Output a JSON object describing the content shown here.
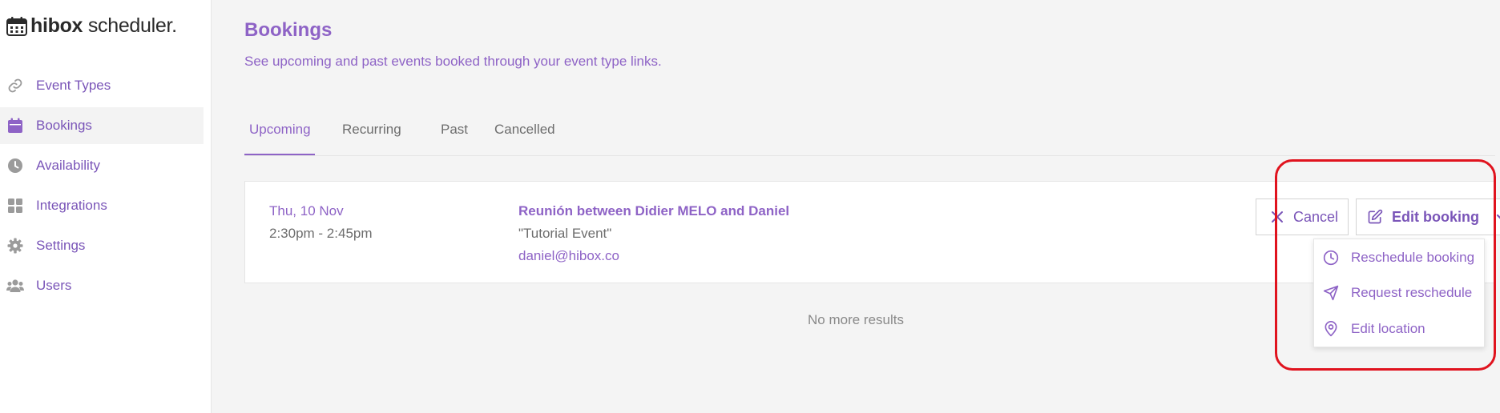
{
  "app": {
    "logo_bold": "hibox",
    "logo_light": " scheduler.",
    "logo_icon": "calendar-icon"
  },
  "sidebar": {
    "items": [
      {
        "label": "Event Types",
        "icon": "link-icon",
        "active": false
      },
      {
        "label": "Bookings",
        "icon": "calendar-icon",
        "active": true
      },
      {
        "label": "Availability",
        "icon": "clock-icon",
        "active": false
      },
      {
        "label": "Integrations",
        "icon": "grid-icon",
        "active": false
      },
      {
        "label": "Settings",
        "icon": "gear-icon",
        "active": false
      },
      {
        "label": "Users",
        "icon": "users-icon",
        "active": false
      }
    ]
  },
  "page": {
    "title": "Bookings",
    "subtitle": "See upcoming and past events booked through your event type links."
  },
  "tabs": [
    {
      "label": "Upcoming",
      "active": true
    },
    {
      "label": "Recurring",
      "active": false
    },
    {
      "label": "Past",
      "active": false
    },
    {
      "label": "Cancelled",
      "active": false
    }
  ],
  "booking": {
    "date": "Thu, 10 Nov",
    "time": "2:30pm - 2:45pm",
    "title": "Reunión between Didier MELO and Daniel",
    "event": "\"Tutorial Event\"",
    "email": "daniel@hibox.co",
    "cancel_label": "Cancel",
    "edit_label": "Edit booking"
  },
  "dropdown": {
    "items": [
      {
        "label": "Reschedule booking",
        "icon": "clock-icon"
      },
      {
        "label": "Request reschedule",
        "icon": "send-icon"
      },
      {
        "label": "Edit location",
        "icon": "map-pin-icon"
      }
    ]
  },
  "empty_state": "No more results",
  "colors": {
    "accent": "#8e63c6",
    "accent_dark": "#7a55b8",
    "muted_text": "#6d6d6d",
    "highlight": "#e0131e",
    "background": "#f4f4f4"
  }
}
